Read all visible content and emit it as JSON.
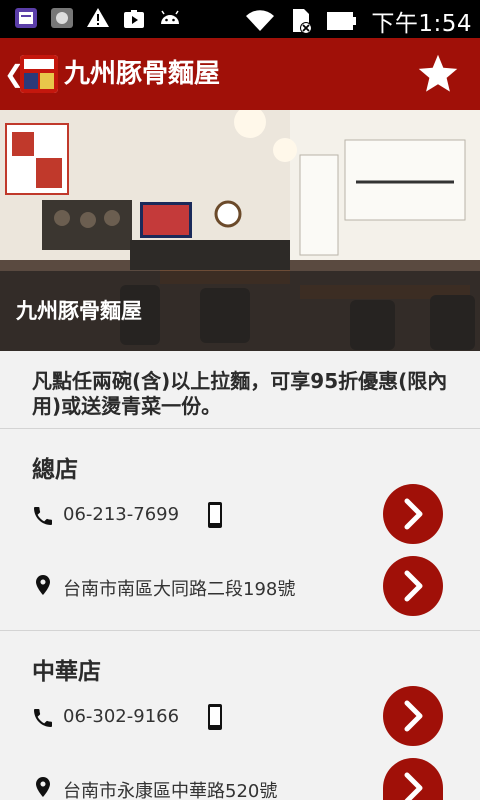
{
  "status_bar": {
    "time": "下午1:54"
  },
  "app_bar": {
    "title": "九州豚骨麵屋",
    "back_icon": "chevron-left-icon",
    "favorite_icon": "star-icon"
  },
  "hero": {
    "caption": "九州豚骨麵屋"
  },
  "promo": {
    "text": "凡點任兩碗(含)以上拉麵，可享95折優惠(限內用)或送燙青菜一份。"
  },
  "branches": [
    {
      "name": "總店",
      "phone": "06-213-7699",
      "address": "台南市南區大同路二段198號"
    },
    {
      "name": "中華店",
      "phone": "06-302-9166",
      "address": "台南市永康區中華路520號"
    }
  ],
  "colors": {
    "brand": "#a01008",
    "background": "#f2f2f2",
    "text": "#2b2b2b"
  }
}
